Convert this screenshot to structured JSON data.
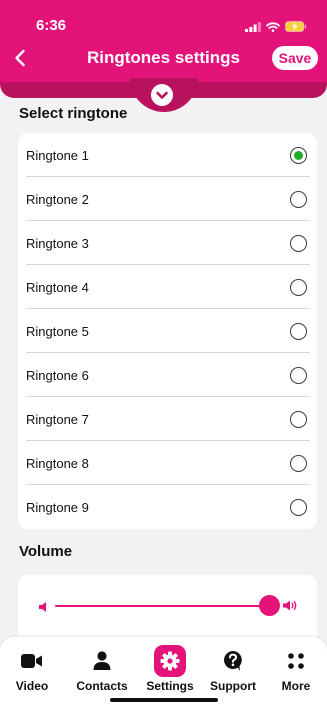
{
  "status_bar": {
    "time": "6:36"
  },
  "header": {
    "title": "Ringtones settings",
    "save_label": "Save",
    "accent_color": "#e4137a"
  },
  "ringtones": {
    "section_title": "Select ringtone",
    "selected_index": 0,
    "items": [
      {
        "label": "Ringtone 1",
        "selected": true
      },
      {
        "label": "Ringtone 2",
        "selected": false
      },
      {
        "label": "Ringtone 3",
        "selected": false
      },
      {
        "label": "Ringtone 4",
        "selected": false
      },
      {
        "label": "Ringtone 5",
        "selected": false
      },
      {
        "label": "Ringtone 6",
        "selected": false
      },
      {
        "label": "Ringtone 7",
        "selected": false
      },
      {
        "label": "Ringtone 8",
        "selected": false
      },
      {
        "label": "Ringtone 9",
        "selected": false
      }
    ]
  },
  "volume": {
    "section_title": "Volume",
    "level_percent": 100
  },
  "tabbar": {
    "active": "settings",
    "tabs": [
      {
        "label": "Video",
        "icon": "video-camera-icon"
      },
      {
        "label": "Contacts",
        "icon": "person-icon"
      },
      {
        "label": "Settings",
        "icon": "gear-icon"
      },
      {
        "label": "Support",
        "icon": "question-bubble-icon"
      },
      {
        "label": "More",
        "icon": "dots-grid-icon"
      }
    ]
  }
}
